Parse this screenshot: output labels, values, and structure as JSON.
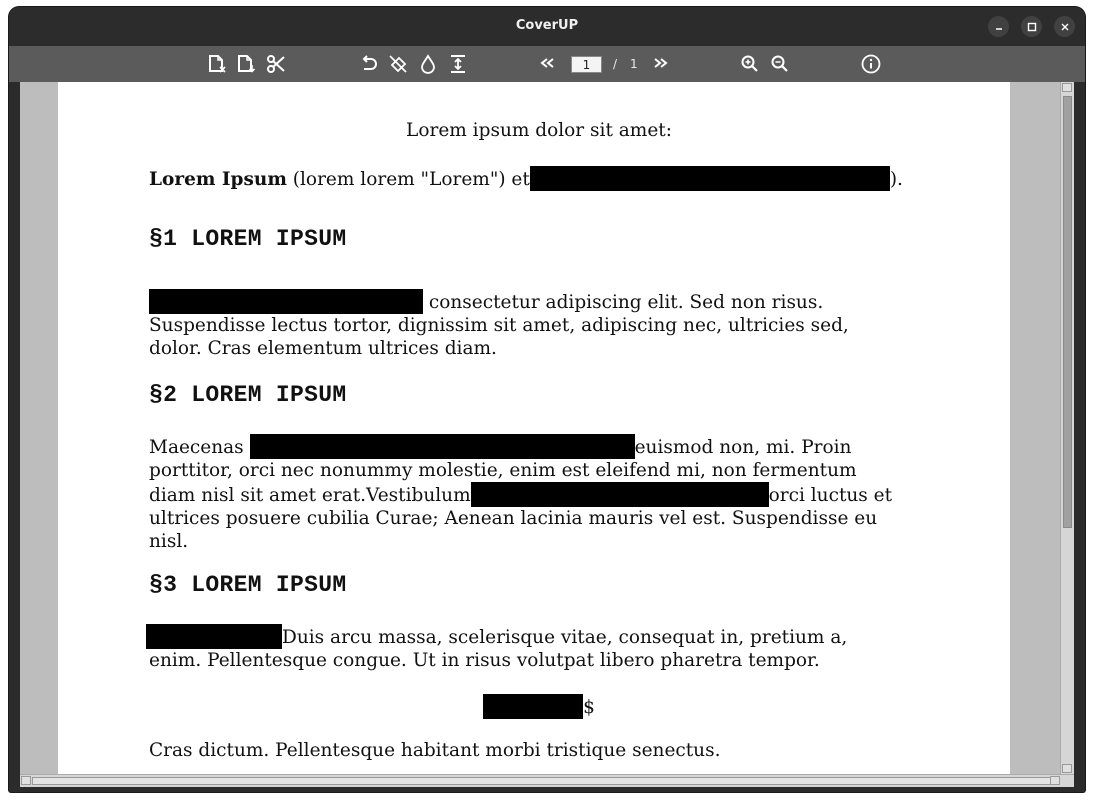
{
  "window": {
    "title": "CoverUP"
  },
  "toolbar": {
    "icons": [
      "open-file-icon",
      "save-file-icon",
      "cut-icon",
      "undo-icon",
      "clear-icon",
      "fill-icon",
      "fit-icon",
      "prev-page-icon",
      "next-page-icon",
      "zoom-in-icon",
      "zoom-out-icon",
      "info-icon"
    ],
    "page_current": "1",
    "page_separator": "/",
    "page_total": "1"
  },
  "document": {
    "intro": "Lorem ipsum dolor sit amet:",
    "line1_bold": "Lorem Ipsum",
    "line1_text": " (lorem lorem \"Lorem\") et",
    "line1_end": ").",
    "heading1": "§1 LOREM IPSUM",
    "p1_line1_tail": " consectetur adipiscing elit. Sed non risus.",
    "p1_line2": "Suspendisse lectus tortor, dignissim sit amet, adipiscing nec, ultricies sed,",
    "p1_line3": "dolor. Cras elementum ultrices diam.",
    "heading2": "§2 LOREM IPSUM",
    "p2_line1_start": "Maecenas ",
    "p2_line1_end": "euismod non, mi. Proin",
    "p2_line2": "porttitor, orci nec nonummy molestie, enim est eleifend mi, non fermentum",
    "p2_line3_start": "diam nisl sit amet erat.Vestibulum",
    "p2_line3_end": "orci luctus et",
    "p2_line4": "ultrices posuere cubilia Curae; Aenean lacinia mauris vel est. Suspendisse eu",
    "p2_line5": "nisl.",
    "heading3": "§3 LOREM IPSUM",
    "p3_line1_tail": "Duis arcu massa, scelerisque vitae, consequat in, pretium a,",
    "p3_line2": "enim. Pellentesque congue. Ut in risus volutpat libero pharetra tempor.",
    "amount_suffix": "$",
    "last_line": "Cras dictum. Pellentesque habitant morbi tristique senectus."
  },
  "colors": {
    "titlebar": "#2c2c2c",
    "toolbar": "#5b5b5b",
    "canvas": "#bdbdbd",
    "redaction": "#000000"
  }
}
